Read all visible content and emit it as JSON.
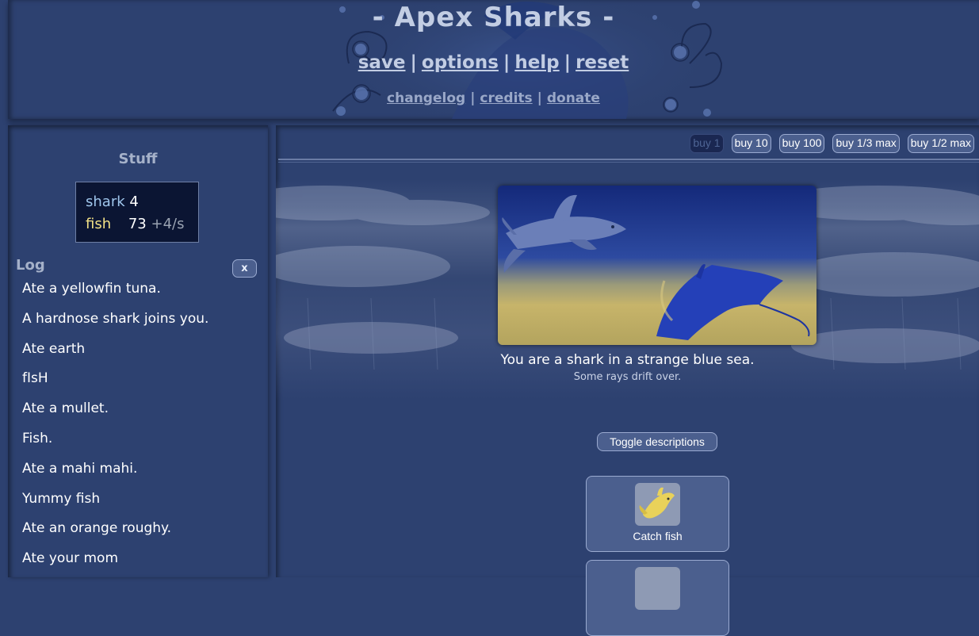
{
  "header": {
    "title": "- Apex Sharks -",
    "menu": [
      "save",
      "options",
      "help",
      "reset"
    ],
    "submenu": [
      "changelog",
      "credits",
      "donate"
    ],
    "separator": "|"
  },
  "stuff": {
    "title": "Stuff",
    "resources": [
      {
        "name": "shark",
        "amount": "4",
        "rate": ""
      },
      {
        "name": "fish",
        "amount": "73",
        "rate": "+4/s"
      }
    ]
  },
  "log": {
    "title": "Log",
    "clear_label": "x",
    "entries": [
      "Ate a yellowfin tuna.",
      "A hardnose shark joins you.",
      "Ate earth",
      "fIsH",
      "Ate a mullet.",
      "Fish.",
      "Ate a mahi mahi.",
      "Yummy fish",
      "Ate an orange roughy.",
      "Ate your mom"
    ]
  },
  "buy": {
    "options": [
      "buy 1",
      "buy 10",
      "buy 100",
      "buy 1/3 max",
      "buy 1/2 max"
    ],
    "selected": "buy 1"
  },
  "scene": {
    "description": "You are a shark in a strange blue sea.",
    "detail": "Some rays drift over."
  },
  "toggle_label": "Toggle descriptions",
  "actions": [
    {
      "label": "Catch fish",
      "icon": "yellow-fish-icon"
    },
    {
      "label": "",
      "icon": "shark-icon"
    }
  ],
  "colors": {
    "background": "#2d4170",
    "button": "#4b5f8e",
    "shark_resource": "#9fc6ec",
    "fish_resource": "#f1e086"
  }
}
